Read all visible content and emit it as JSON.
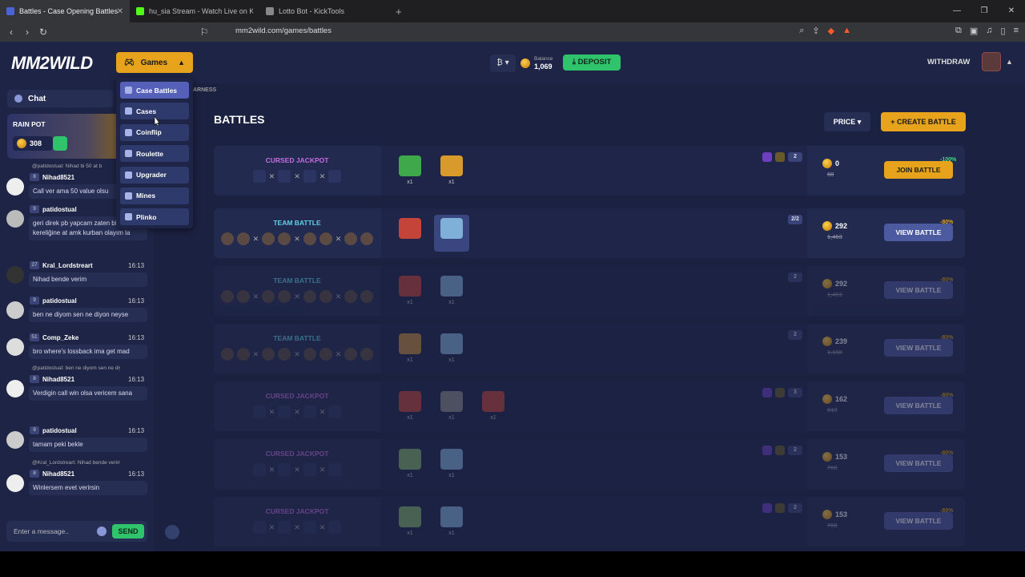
{
  "browser": {
    "tabs": [
      {
        "title": "Battles - Case Opening Battles",
        "active": true
      },
      {
        "title": "hu_sia Stream - Watch Live on Ki",
        "active": false
      },
      {
        "title": "Lotto Bot - KickTools",
        "active": false
      }
    ],
    "url": "mm2wild.com/games/battles"
  },
  "header": {
    "logo": "MM2WILD",
    "games_label": "Games",
    "balance_label": "Balance",
    "balance_value": "1,069",
    "deposit_label": "DEPOSIT",
    "withdraw_label": "WITHDRAW"
  },
  "games_menu": [
    {
      "label": "Case Battles",
      "active": true
    },
    {
      "label": "Cases"
    },
    {
      "label": "Coinflip"
    },
    {
      "label": "Roulette"
    },
    {
      "label": "Upgrader"
    },
    {
      "label": "Mines"
    },
    {
      "label": "Plinko"
    }
  ],
  "fairness_fragment": "ARNESS",
  "sidebar": {
    "chat_label": "Chat",
    "rain_pot_label": "RAIN POT",
    "rain_pot_amount": "308",
    "messages": [
      {
        "reply": "@patidostual: Nihad bi 50 at b",
        "level": "8",
        "name": "Nihad8521",
        "time": "",
        "text": "Call ver ama 50 value olsu"
      },
      {
        "reply": "",
        "level": "9",
        "name": "patidostual",
        "time": "",
        "text": "geri direk pb yapcam zaten bir kereliğine at amk kurban olayım la"
      },
      {
        "reply": "",
        "level": "27",
        "name": "Kral_Lordstreart",
        "time": "16:13",
        "text": "Nihad bende verim"
      },
      {
        "reply": "",
        "level": "9",
        "name": "patidostual",
        "time": "16:13",
        "text": "ben ne diyom sen ne diyon neyse"
      },
      {
        "reply": "",
        "level": "51",
        "name": "Comp_Zeke",
        "time": "16:13",
        "text": "bro where's lossback ima get mad"
      },
      {
        "reply": "@patidostual: ben ne diyom sen ne diyon...",
        "level": "8",
        "name": "Nihad8521",
        "time": "16:13",
        "text": "Verdigin call win olsa vericem sana"
      },
      {
        "reply": "",
        "level": "9",
        "name": "patidostual",
        "time": "16:13",
        "text": "tamam peki bekle"
      },
      {
        "reply": "@Kral_Lordstreart: Nihad bende verim",
        "level": "8",
        "name": "Nihad8521",
        "time": "16:13",
        "text": "Winlersem evet verirsin"
      }
    ],
    "input_placeholder": "Enter a message..",
    "send_label": "SEND"
  },
  "main": {
    "title": "BATTLES",
    "price_label": "PRICE",
    "create_label": "CREATE BATTLE",
    "battles": [
      {
        "mode": "CURSED JACKPOT",
        "mode_color": "#c46be0",
        "badges": [
          "crown-purple",
          "crown-gold",
          "2"
        ],
        "price": "0",
        "old": "60",
        "action": "JOIN BATTLE",
        "action_type": "join",
        "discount": "-100%",
        "cases": 2,
        "dim": false
      },
      {
        "mode": "TEAM BATTLE",
        "mode_color": "#5fd0e8",
        "badges": [
          "2/2"
        ],
        "price": "292",
        "old": "1,463",
        "action": "VIEW BATTLE",
        "action_type": "view",
        "discount": "-80%",
        "cases": 2,
        "dim": false
      },
      {
        "mode": "TEAM BATTLE",
        "mode_color": "#5fd0e8",
        "badges": [
          "2"
        ],
        "price": "292",
        "old": "1,463",
        "action": "VIEW BATTLE",
        "action_type": "view",
        "discount": "-80%",
        "cases": 2,
        "dim": true
      },
      {
        "mode": "TEAM BATTLE",
        "mode_color": "#5fd0e8",
        "badges": [
          "2"
        ],
        "price": "239",
        "old": "1,198",
        "action": "VIEW BATTLE",
        "action_type": "view",
        "discount": "-80%",
        "cases": 2,
        "dim": true
      },
      {
        "mode": "CURSED JACKPOT",
        "mode_color": "#c46be0",
        "badges": [
          "crown-purple",
          "crown-gold",
          "3"
        ],
        "price": "162",
        "old": "813",
        "action": "VIEW BATTLE",
        "action_type": "view",
        "discount": "-80%",
        "cases": 3,
        "dim": true
      },
      {
        "mode": "CURSED JACKPOT",
        "mode_color": "#c46be0",
        "badges": [
          "crown-purple",
          "crown-gold",
          "2"
        ],
        "price": "153",
        "old": "768",
        "action": "VIEW BATTLE",
        "action_type": "view",
        "discount": "-80%",
        "cases": 2,
        "dim": true
      },
      {
        "mode": "CURSED JACKPOT",
        "mode_color": "#c46be0",
        "badges": [
          "crown-purple",
          "crown-gold",
          "2"
        ],
        "price": "153",
        "old": "768",
        "action": "VIEW BATTLE",
        "action_type": "view",
        "discount": "-80%",
        "cases": 2,
        "dim": true
      }
    ],
    "case_count_label": "x1"
  },
  "colors": {
    "accent": "#e7a31c",
    "deposit": "#2fc46c",
    "bg": "#1b2140"
  }
}
